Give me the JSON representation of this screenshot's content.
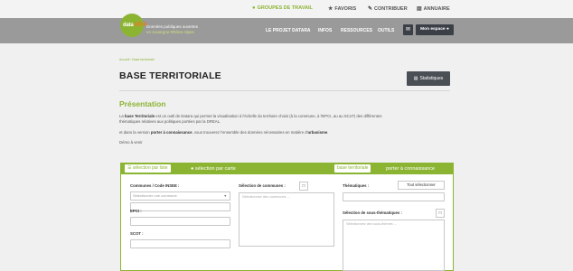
{
  "topnav": {
    "groups": "GROUPES DE TRAVAIL",
    "favorites": "FAVORIS",
    "contribute": "CONTRIBUER",
    "directory": "ANNUAIRE",
    "active_color": "#8cb433"
  },
  "header": {
    "logo_prefix": "data",
    "logo_letters": "ARA",
    "tagline_line1": "Données publiques ouvertes",
    "tagline_line2": "en Auvergne-Rhône-Alpes",
    "nav": [
      "LE PROJET DATARA",
      "INFOS",
      "RESSOURCES",
      "OUTILS"
    ],
    "space_button": "Mon espace"
  },
  "breadcrumb": {
    "home": "Accueil",
    "current": "Base territoriale"
  },
  "page": {
    "title": "BASE TERRITORIALE",
    "stats_button": "Statistiques",
    "section_title": "Présentation",
    "p1_start": "La ",
    "p1_bold": "base Territoriale",
    "p1_rest": " est un outil de Datara qui permet la visualisation à l'échelle du territoire choisi (à la commune, à l'EPCI, au au SCoT) des différentes thématiques relatives aux politiques portées par la DREAL.",
    "p2_start": "et dans la version ",
    "p2_bold": "porter à connaissance",
    "p2_rest": ", vous trouverez l'ensemble des données nécessaires en matière d'",
    "p2_bold2": "urbanisme",
    "p2_end": ".",
    "p3": "Démo à venir"
  },
  "panel": {
    "mode_list": "sélection par liste",
    "mode_map": "sélection par carte",
    "base_label": "base territoriale",
    "pac_label": "porter à connaissance",
    "communes_label": "Communes / Code INSEE :",
    "communes_placeholder": "Sélectionner une commune",
    "epci_label": "EPCI :",
    "scot_label": "SCOT :",
    "selection_communes": "Sélection de communes :",
    "selection_communes_placeholder": "Sélectionnez des communes ...",
    "thematiques_label": "Thématiques :",
    "tout_button": "Tout sélectionner",
    "sous_thematiques": "Sélection de sous-thématiques :",
    "sous_placeholder": "Sélectionnez des sous-thèmes ..."
  }
}
